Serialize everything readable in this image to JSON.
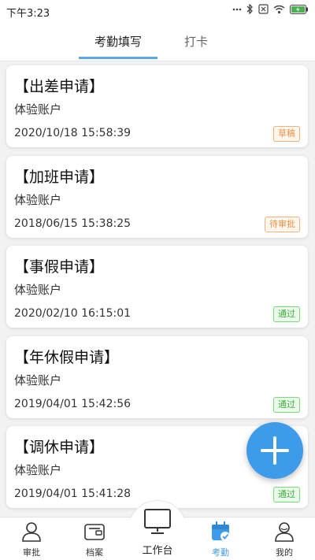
{
  "status_bar": {
    "time": "下午3:23",
    "icons": [
      "signal-dots-icon",
      "bluetooth-icon",
      "no-sim-icon",
      "wifi-icon",
      "battery-charging-icon"
    ]
  },
  "tabs": {
    "active": "考勤填写",
    "inactive": "打卡"
  },
  "cards": [
    {
      "title": "【出差申请】",
      "user": "体验账户",
      "time": "2020/10/18 15:58:39",
      "status": "草稿"
    },
    {
      "title": "【加班申请】",
      "user": "体验账户",
      "time": "2018/06/15 15:38:25",
      "status": "待审批"
    },
    {
      "title": "【事假申请】",
      "user": "体验账户",
      "time": "2020/02/10 16:15:01",
      "status": "通过"
    },
    {
      "title": "【年休假申请】",
      "user": "体验账户",
      "time": "2019/04/01 15:42:56",
      "status": "通过"
    },
    {
      "title": "【调休申请】",
      "user": "体验账户",
      "time": "2019/04/01 15:41:28",
      "status": "通过"
    }
  ],
  "colors": {
    "accent": "#3d9be9",
    "draft": "#e8914a",
    "approved": "#3fae3f"
  },
  "fab": {
    "icon": "plus-icon"
  },
  "bottom_nav": {
    "approval": "审批",
    "archive": "档案",
    "workbench": "工作台",
    "attendance": "考勤",
    "mine": "我的"
  }
}
